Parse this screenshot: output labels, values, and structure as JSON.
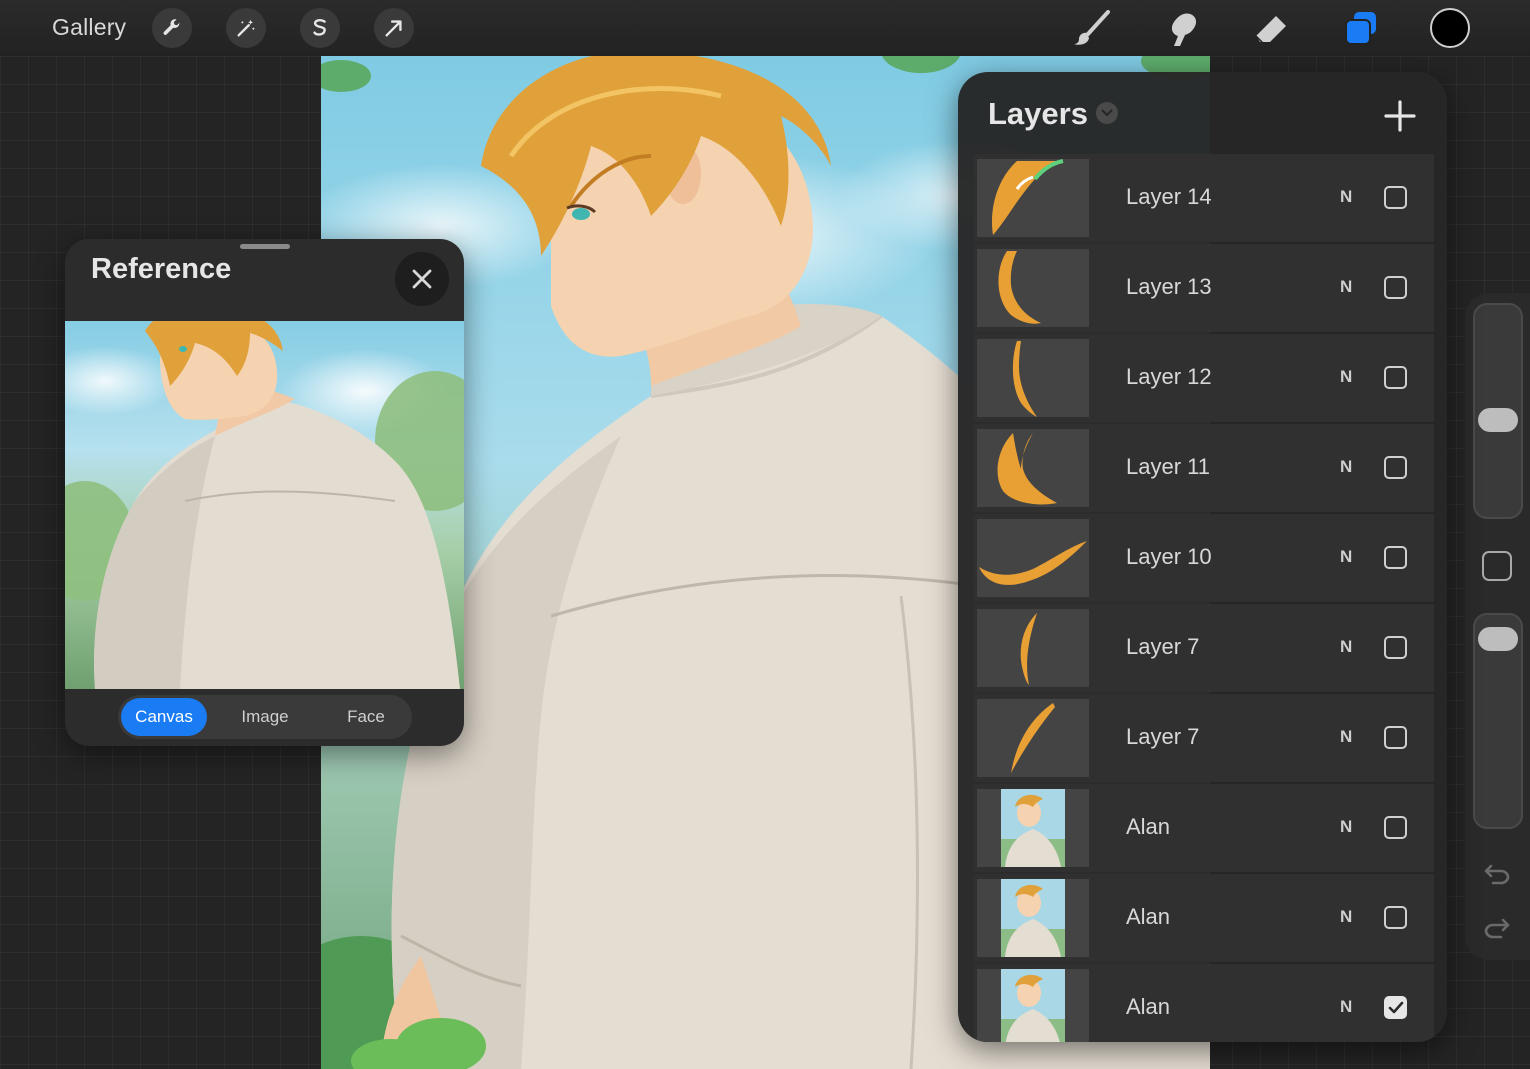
{
  "toolbar": {
    "gallery_label": "Gallery",
    "left_tools": [
      "wrench-icon",
      "magic-wand-icon",
      "selection-icon",
      "transform-arrow-icon"
    ],
    "right_tools": [
      "brush-icon",
      "smudge-icon",
      "eraser-icon",
      "layers-icon"
    ],
    "current_color": "#000000",
    "accent": "#1a7cf5"
  },
  "reference": {
    "title": "Reference",
    "tabs": [
      {
        "label": "Canvas",
        "active": true
      },
      {
        "label": "Image",
        "active": false
      },
      {
        "label": "Face",
        "active": false
      }
    ]
  },
  "layers": {
    "title": "Layers",
    "items": [
      {
        "name": "Layer 14",
        "mode": "N",
        "visible": false
      },
      {
        "name": "Layer 13",
        "mode": "N",
        "visible": false
      },
      {
        "name": "Layer 12",
        "mode": "N",
        "visible": false
      },
      {
        "name": "Layer 11",
        "mode": "N",
        "visible": false
      },
      {
        "name": "Layer 10",
        "mode": "N",
        "visible": false
      },
      {
        "name": "Layer 7",
        "mode": "N",
        "visible": false
      },
      {
        "name": "Layer 7",
        "mode": "N",
        "visible": false
      },
      {
        "name": "Alan",
        "mode": "N",
        "visible": false
      },
      {
        "name": "Alan",
        "mode": "N",
        "visible": false
      },
      {
        "name": "Alan",
        "mode": "N",
        "visible": true
      }
    ]
  },
  "sidebar": {
    "brush_size": 0.45,
    "opacity": 0.95
  }
}
